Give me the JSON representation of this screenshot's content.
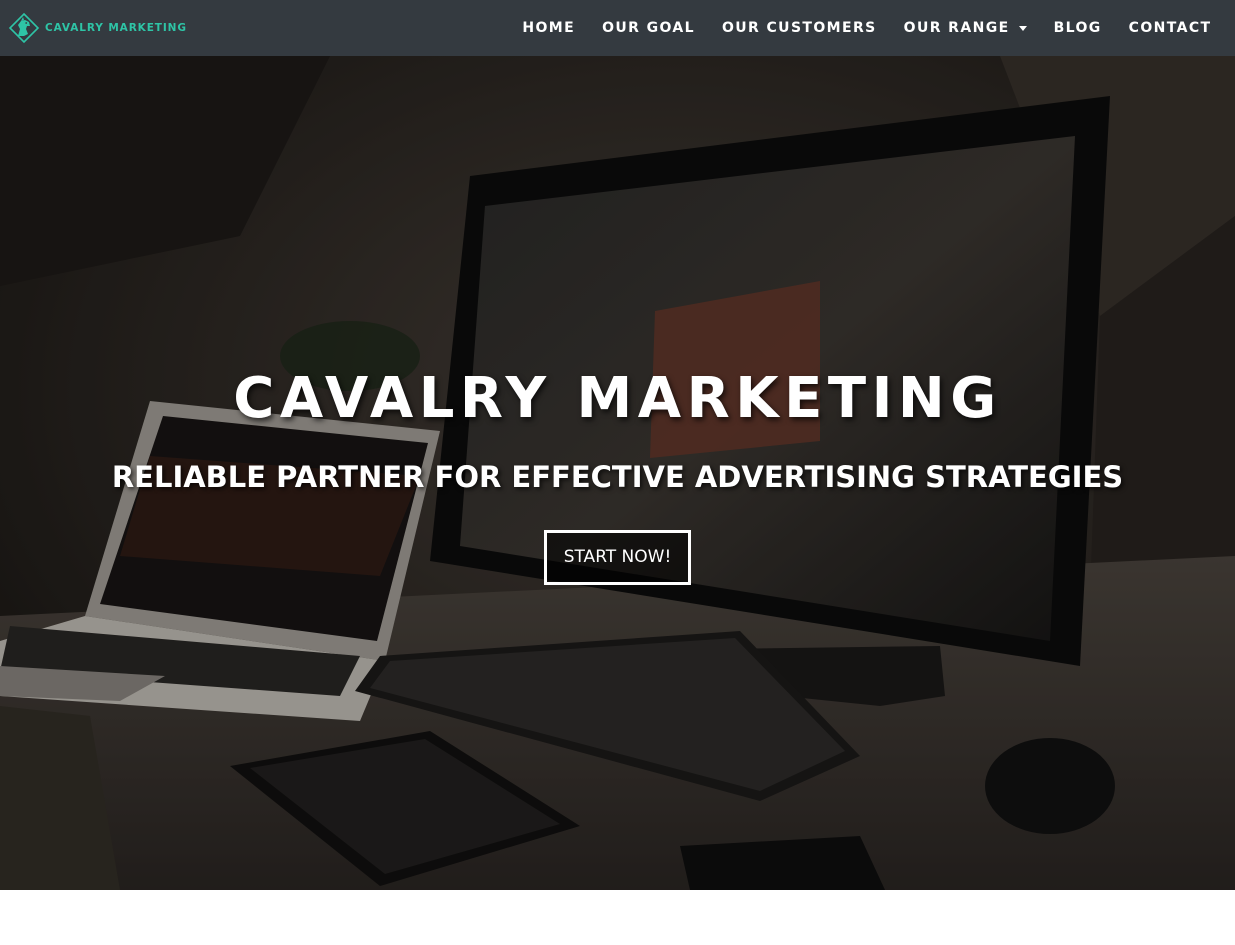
{
  "brand": {
    "name": "CAVALRY MARKETING",
    "logo_icon": "horse-head-logo",
    "color": "#2ec4a6"
  },
  "navbar": {
    "background": "#343a40",
    "items": [
      {
        "label": "HOME",
        "dropdown": false
      },
      {
        "label": "OUR GOAL",
        "dropdown": false
      },
      {
        "label": "OUR CUSTOMERS",
        "dropdown": false
      },
      {
        "label": "OUR RANGE",
        "dropdown": true
      },
      {
        "label": "BLOG",
        "dropdown": false
      },
      {
        "label": "CONTACT",
        "dropdown": false
      }
    ]
  },
  "hero": {
    "title": "CAVALRY MARKETING",
    "subtitle": "RELIABLE PARTNER FOR EFFECTIVE ADVERTISING STRATEGIES",
    "cta_label": "START NOW!",
    "background_image": "dark desk with laptop, monitor, keyboard, tablet and mouse"
  }
}
